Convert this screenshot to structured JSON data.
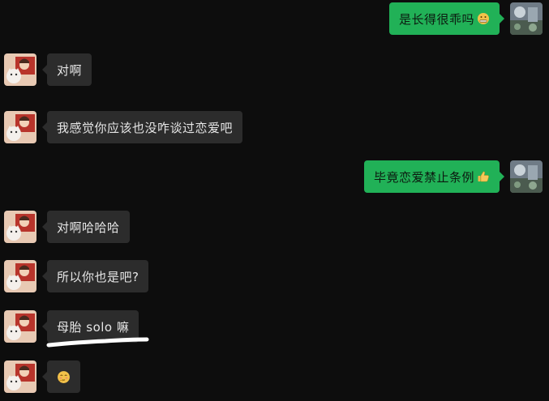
{
  "messages": [
    {
      "side": "right",
      "text": "是长得很乖吗",
      "emoji": "grimace-emoji"
    },
    {
      "side": "left",
      "text": "对啊",
      "emoji": ""
    },
    {
      "side": "left",
      "text": "我感觉你应该也没咋谈过恋爱吧",
      "emoji": ""
    },
    {
      "side": "right",
      "text": "毕竟恋爱禁止条例",
      "emoji": "thumbs-up-emoji"
    },
    {
      "side": "left",
      "text": "对啊哈哈哈",
      "emoji": ""
    },
    {
      "side": "left",
      "text": "所以你也是吧?",
      "emoji": ""
    },
    {
      "side": "left",
      "text": "母胎 solo 嘛",
      "emoji": ""
    },
    {
      "side": "left",
      "text": "",
      "emoji": "shy-face-emoji"
    }
  ],
  "colors": {
    "background": "#0d0d0d",
    "incoming_bubble": "#2c2c2c",
    "outgoing_bubble": "#21b157",
    "annotation_underline": "#ffffff"
  }
}
